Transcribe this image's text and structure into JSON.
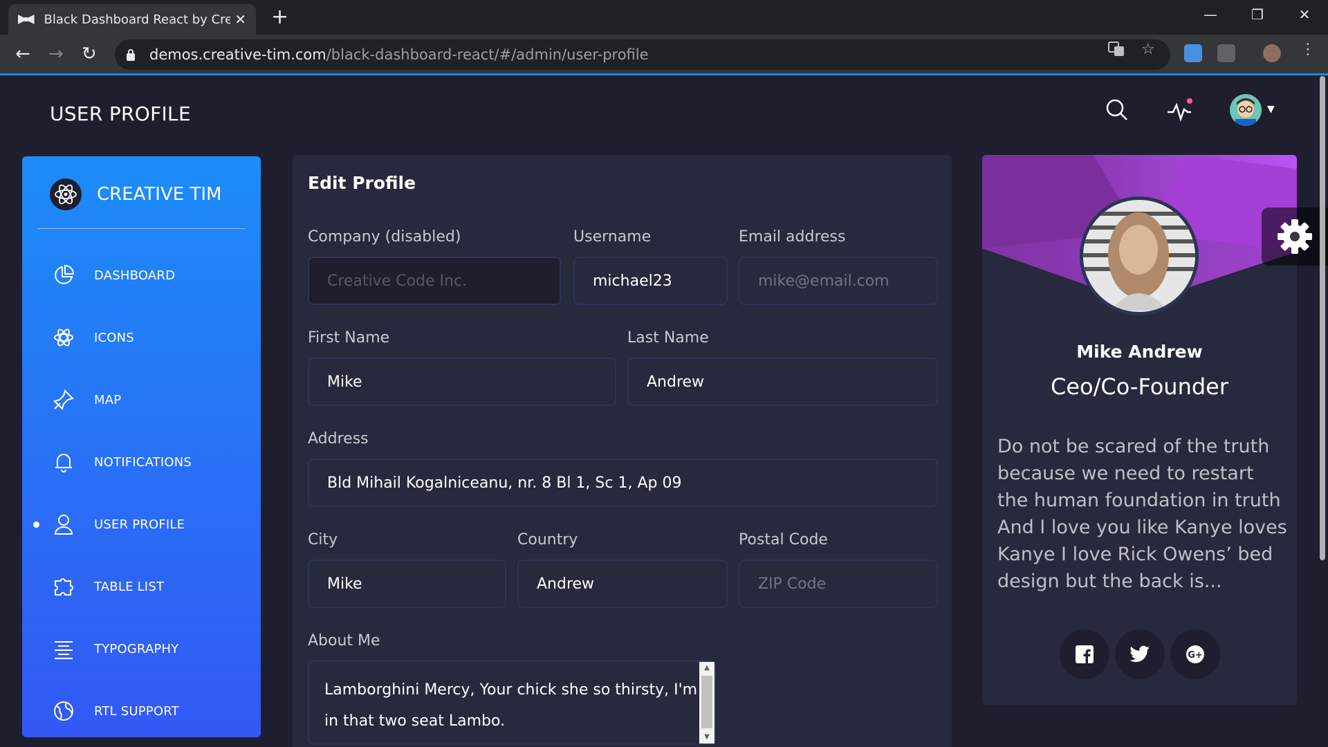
{
  "browser": {
    "tab_title": "Black Dashboard React by Creat",
    "tab_close": "✕",
    "new_tab": "+",
    "url_host": "demos.creative-tim.com",
    "url_path": "/black-dashboard-react/#/admin/user-profile"
  },
  "header": {
    "page_title": "USER PROFILE"
  },
  "sidebar": {
    "brand": "CREATIVE TIM",
    "items": [
      {
        "label": "DASHBOARD",
        "icon": "chart-pie-icon"
      },
      {
        "label": "ICONS",
        "icon": "atom-icon"
      },
      {
        "label": "MAP",
        "icon": "pin-icon"
      },
      {
        "label": "NOTIFICATIONS",
        "icon": "bell-icon"
      },
      {
        "label": "USER PROFILE",
        "icon": "user-icon",
        "active": true
      },
      {
        "label": "TABLE LIST",
        "icon": "puzzle-icon"
      },
      {
        "label": "TYPOGRAPHY",
        "icon": "align-center-icon"
      },
      {
        "label": "RTL SUPPORT",
        "icon": "world-icon"
      }
    ]
  },
  "edit_profile": {
    "title": "Edit Profile",
    "company_label": "Company (disabled)",
    "company_value": "Creative Code Inc.",
    "username_label": "Username",
    "username_value": "michael23",
    "email_label": "Email address",
    "email_placeholder": "mike@email.com",
    "first_name_label": "First Name",
    "first_name_value": "Mike",
    "last_name_label": "Last Name",
    "last_name_value": "Andrew",
    "address_label": "Address",
    "address_value": "Bld Mihail Kogalniceanu, nr. 8 Bl 1, Sc 1, Ap 09",
    "city_label": "City",
    "city_value": "Mike",
    "country_label": "Country",
    "country_value": "Andrew",
    "postal_label": "Postal Code",
    "postal_placeholder": "ZIP Code",
    "about_label": "About Me",
    "about_value": "Lamborghini Mercy, Your chick she so thirsty, I'm in that two seat Lambo."
  },
  "profile": {
    "name": "Mike Andrew",
    "role": "Ceo/Co-Founder",
    "description": "Do not be scared of the truth because we need to restart the human foundation in truth And I love you like Kanye loves Kanye I love Rick Owens’ bed design but the back is..."
  },
  "colors": {
    "sidebar_top": "#1d8cf8",
    "sidebar_bottom": "#3358f4",
    "card_bg": "#27293d",
    "page_bg": "#1e1e2f",
    "profile_accent": "#ba54f5",
    "notification_dot": "#fd5d93"
  }
}
